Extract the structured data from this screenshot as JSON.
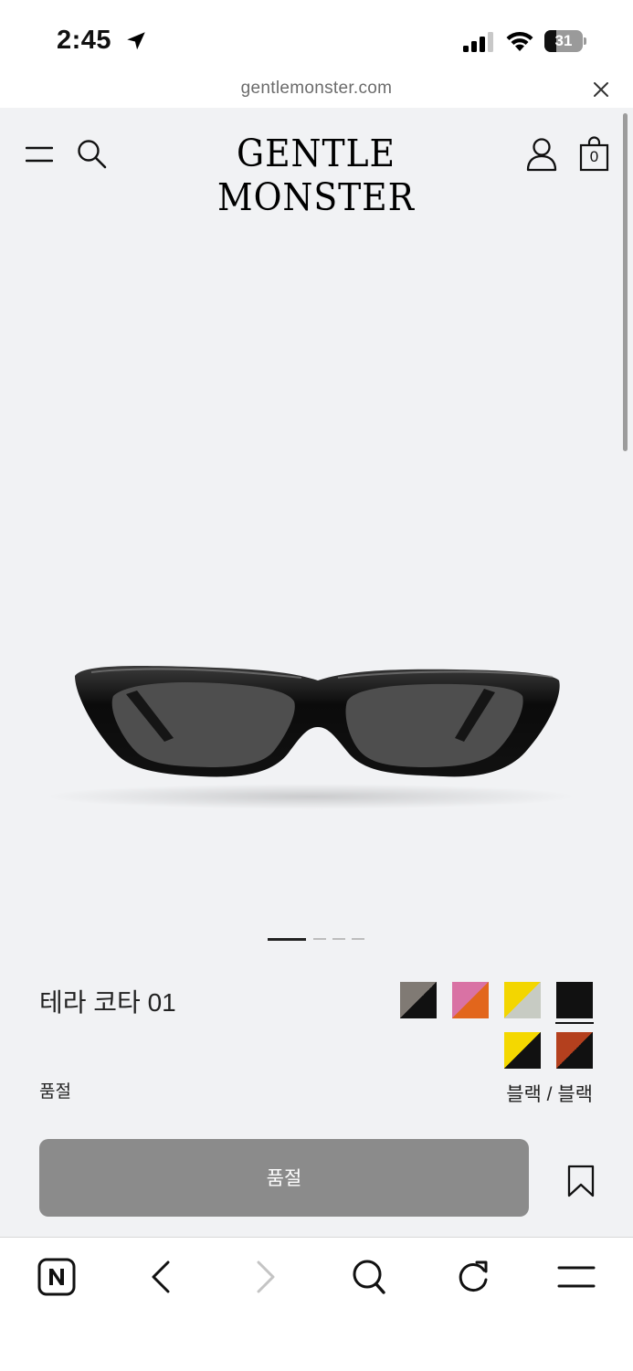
{
  "status_bar": {
    "time": "2:45",
    "battery_level": "31",
    "battery_fraction": 0.31,
    "icons": [
      "location-arrow-icon",
      "cellular-signal-icon",
      "wifi-icon",
      "battery-icon"
    ]
  },
  "browser": {
    "url": "gentlemonster.com",
    "close_icon": "close-icon",
    "toolbar_icons": [
      "naver-home-icon",
      "back-icon",
      "forward-icon",
      "search-icon",
      "reload-icon",
      "menu-icon"
    ]
  },
  "header": {
    "logo": "GENTLE MONSTER",
    "cart_count": "0",
    "icons": [
      "menu-icon",
      "search-icon",
      "user-icon",
      "shopping-bag-icon"
    ]
  },
  "carousel": {
    "slides": 4,
    "active_index": 0
  },
  "product": {
    "name": "테라 코타 01",
    "stock_status": "품절",
    "color_name": "블랙 / 블랙",
    "button_label": "품절",
    "swatches": [
      {
        "id": "gray-black",
        "a": "#807a74",
        "b": "#111111",
        "selected": false
      },
      {
        "id": "pink-orange",
        "a": "#d972a4",
        "b": "#e2661c",
        "selected": false
      },
      {
        "id": "yellow-clear",
        "a": "#f3d600",
        "b": "#c7cbc3",
        "selected": false
      },
      {
        "id": "black",
        "a": "#111111",
        "b": "#111111",
        "selected": true
      },
      {
        "id": "yellow-black",
        "a": "#f4d800",
        "b": "#111111",
        "selected": false
      },
      {
        "id": "brown-black",
        "a": "#b4401e",
        "b": "#111111",
        "selected": false
      }
    ]
  },
  "colors": {
    "background": "#f1f2f4",
    "button": "#8b8b8b",
    "text": "#222222"
  }
}
